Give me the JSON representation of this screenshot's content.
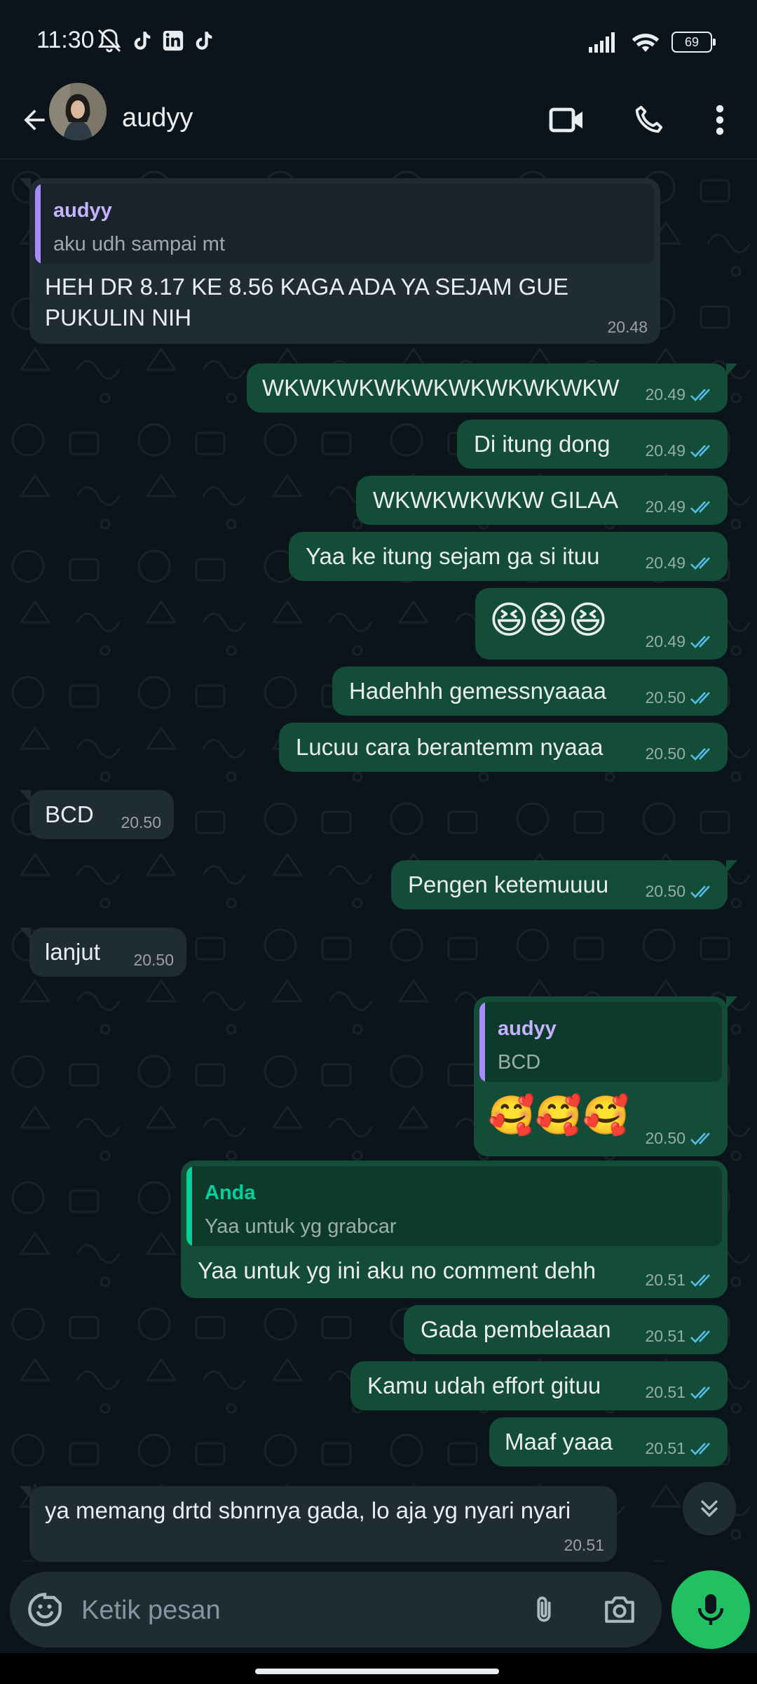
{
  "status_bar": {
    "time": "11:30",
    "battery": "69"
  },
  "header": {
    "contact_name": "audyy"
  },
  "messages": [
    {
      "dir": "in",
      "quote_author": "audyy",
      "quote_text": "aku udh sampai mt",
      "lines": [
        "HEH DR 8.17 KE 8.56 KAGA ADA YA SEJAM GUE",
        "PUKULIN NIH"
      ],
      "time": "20.48"
    },
    {
      "dir": "out",
      "text": "WKWKWKWKWKWKWKWKWKW",
      "time": "20.49"
    },
    {
      "dir": "out",
      "text": "Di itung dong",
      "time": "20.49"
    },
    {
      "dir": "out",
      "text": "WKWKWKWKW GILAA",
      "time": "20.49"
    },
    {
      "dir": "out",
      "text": "Yaa ke itung sejam ga si ituu",
      "time": "20.49"
    },
    {
      "dir": "out",
      "emoji": "😆😆😆",
      "time": "20.49"
    },
    {
      "dir": "out",
      "text": "Hadehhh gemessnyaaaa",
      "time": "20.50"
    },
    {
      "dir": "out",
      "text": "Lucuu cara berantemm nyaaa",
      "time": "20.50"
    },
    {
      "dir": "in",
      "text": "BCD",
      "time": "20.50"
    },
    {
      "dir": "out",
      "text": "Pengen ketemuuuu",
      "time": "20.50"
    },
    {
      "dir": "in",
      "text": "lanjut",
      "time": "20.50"
    },
    {
      "dir": "out",
      "quote_author": "audyy",
      "quote_text": "BCD",
      "emoji": "🥰🥰🥰",
      "time": "20.50"
    },
    {
      "dir": "out",
      "quote_author": "Anda",
      "quote_text": "Yaa untuk yg grabcar",
      "text": "Yaa untuk yg ini aku no comment dehh",
      "time": "20.51"
    },
    {
      "dir": "out",
      "text": "Gada pembelaaan",
      "time": "20.51"
    },
    {
      "dir": "out",
      "text": "Kamu udah effort gituu",
      "time": "20.51"
    },
    {
      "dir": "out",
      "text": "Maaf yaaa",
      "time": "20.51"
    },
    {
      "dir": "in",
      "text": "ya memang drtd sbnrnya gada, lo aja yg nyari nyari",
      "time": "20.51"
    }
  ],
  "composer": {
    "placeholder": "Ketik pesan"
  },
  "colors": {
    "background": "#0b141a",
    "incoming_bubble": "#202c33",
    "outgoing_bubble": "#144d37",
    "read_ticks": "#53bdeb",
    "mic_button": "#21c063",
    "quote_audyy": "#a78bfa",
    "quote_anda": "#06cf9c"
  },
  "icons": [
    "back-arrow-icon",
    "video-call-icon",
    "phone-icon",
    "more-vert-icon",
    "emoji-icon",
    "attach-icon",
    "camera-icon",
    "mic-icon",
    "scroll-down-icon",
    "signal-icon",
    "wifi-icon",
    "battery-icon",
    "mute-icon",
    "tiktok-icon",
    "linkedin-icon"
  ]
}
